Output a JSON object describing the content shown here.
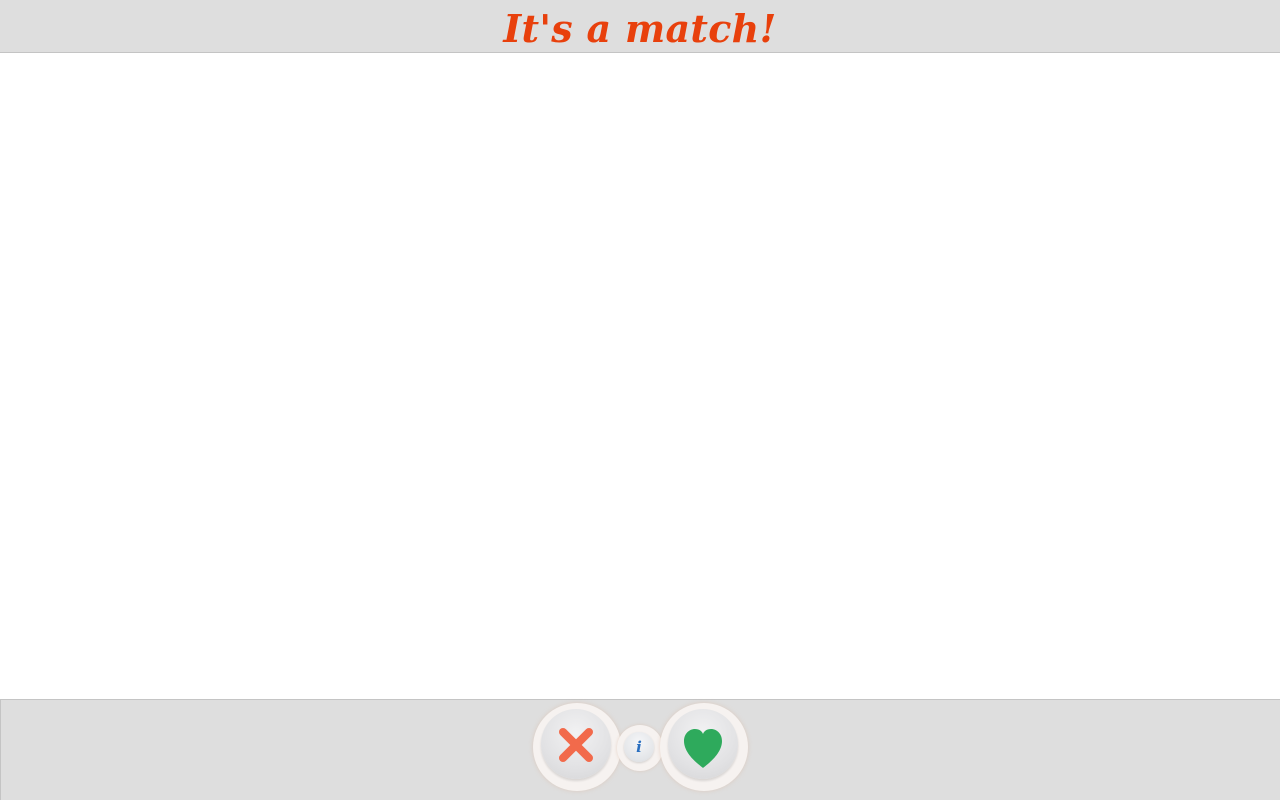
{
  "header": {
    "title": "It's a match!"
  },
  "actions": {
    "info_glyph": "i",
    "nope_icon": "close-icon",
    "like_icon": "heart-icon",
    "nope_color": "#f26a4b",
    "like_color": "#2eaa5c",
    "info_color": "#2a6fc0"
  },
  "colors": {
    "bar_background": "#dedede",
    "title_color": "#e8400c"
  }
}
